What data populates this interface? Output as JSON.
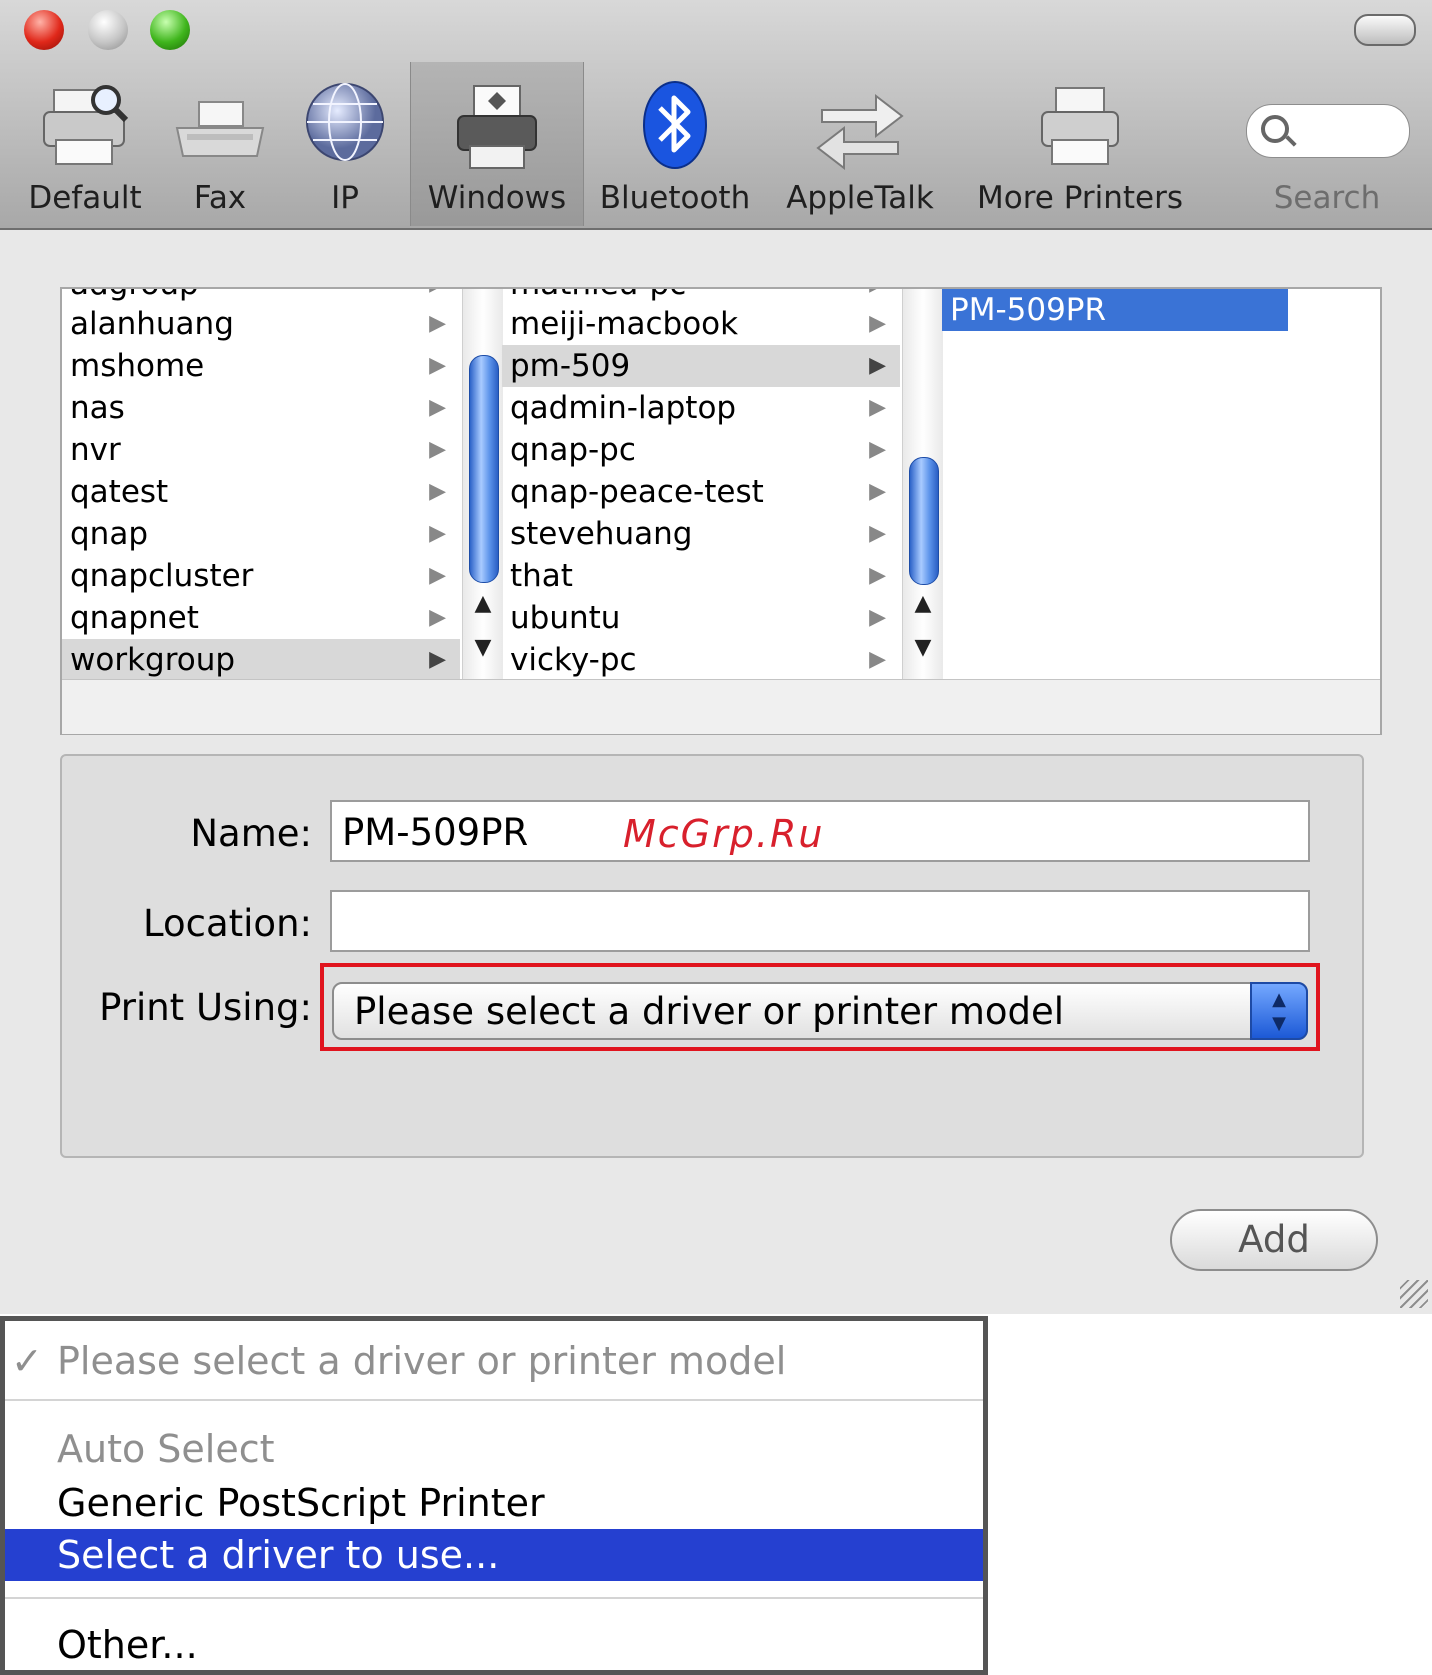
{
  "toolbar": {
    "items": [
      {
        "label": "Default",
        "icon": "default-printer-icon"
      },
      {
        "label": "Fax",
        "icon": "fax-icon"
      },
      {
        "label": "IP",
        "icon": "globe-icon"
      },
      {
        "label": "Windows",
        "icon": "windows-printer-icon"
      },
      {
        "label": "Bluetooth",
        "icon": "bluetooth-icon"
      },
      {
        "label": "AppleTalk",
        "icon": "appletalk-arrows-icon"
      },
      {
        "label": "More Printers",
        "icon": "printer-icon"
      }
    ],
    "search_label": "Search"
  },
  "browser": {
    "column1": [
      "adgroup",
      "alanhuang",
      "mshome",
      "nas",
      "nvr",
      "qatest",
      "qnap",
      "qnapcluster",
      "qnapnet",
      "workgroup"
    ],
    "column2": [
      "mathieu-pc",
      "meiji-macbook",
      "pm-509",
      "qadmin-laptop",
      "qnap-pc",
      "qnap-peace-test",
      "stevehuang",
      "that",
      "ubuntu",
      "vicky-pc"
    ],
    "column3": [
      "PM-509PR"
    ]
  },
  "form": {
    "name_label": "Name:",
    "name_value": "PM-509PR",
    "location_label": "Location:",
    "location_value": "",
    "print_using_label": "Print Using:",
    "print_using_value": "Please select a driver or printer model",
    "watermark": "McGrp.Ru"
  },
  "add_button": "Add",
  "menu": {
    "checked_item": "Please select a driver or printer model",
    "auto_select": "Auto Select",
    "generic": "Generic PostScript Printer",
    "select_driver": "Select a driver to use...",
    "other": "Other..."
  },
  "colors": {
    "selection_blue": "#3a73d6",
    "menu_highlight": "#2540d0",
    "red_highlight": "#e0141e"
  }
}
